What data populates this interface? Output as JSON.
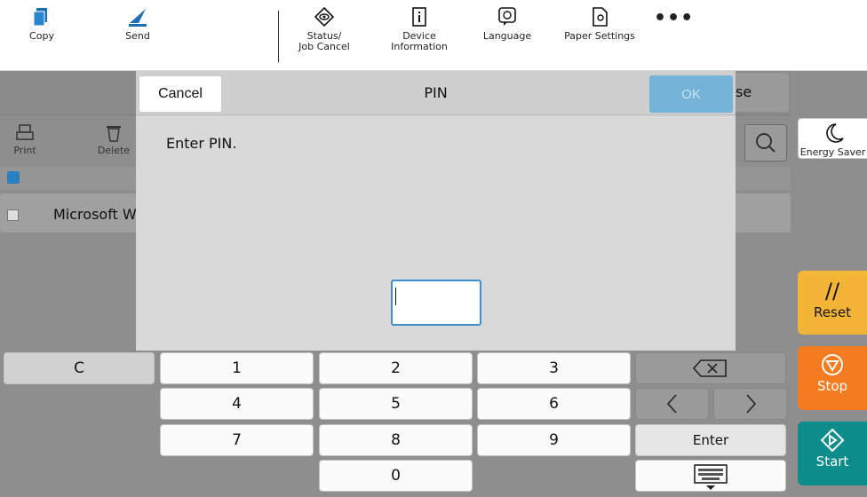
{
  "toolbar": {
    "copy": "Copy",
    "send": "Send",
    "status_line1": "Status/",
    "status_line2": "Job Cancel",
    "device_line1": "Device",
    "device_line2": "Information",
    "language": "Language",
    "paper_settings": "Paper Settings",
    "more": "•••"
  },
  "background": {
    "close_fragment": "se",
    "print": "Print",
    "delete": "Delete",
    "item_name": "Microsoft W"
  },
  "modal": {
    "cancel": "Cancel",
    "title": "PIN",
    "ok": "OK",
    "message": "Enter PIN.",
    "pin_value": ""
  },
  "keypad": {
    "clear": "C",
    "k1": "1",
    "k2": "2",
    "k3": "3",
    "k4": "4",
    "k5": "5",
    "k6": "6",
    "k7": "7",
    "k8": "8",
    "k9": "9",
    "k0": "0",
    "enter": "Enter"
  },
  "side": {
    "energy_saver": "Energy Saver",
    "reset": "Reset",
    "stop": "Stop",
    "start": "Start"
  },
  "colors": {
    "accent": "#3f8fcf",
    "reset": "#f4b536",
    "stop": "#f47b20",
    "start": "#0c8c8a"
  }
}
